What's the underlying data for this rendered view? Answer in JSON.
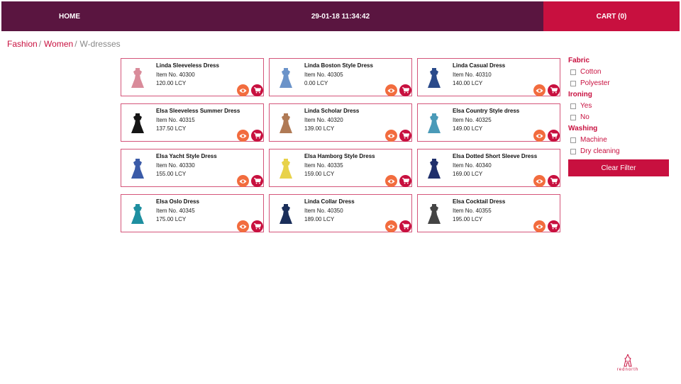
{
  "nav": {
    "home_label": "HOME",
    "clock": "29-01-18 11:34:42",
    "cart_label": "CART (0)"
  },
  "breadcrumb": {
    "items": [
      "Fashion",
      "Women",
      "W-dresses"
    ],
    "separator": "/"
  },
  "products": [
    {
      "name": "Linda Sleeveless Dress",
      "item": "Item No. 40300",
      "price": "120.00 LCY",
      "color": "#d98b9a"
    },
    {
      "name": "Linda Boston Style Dress",
      "item": "Item No. 40305",
      "price": "0.00 LCY",
      "color": "#6b93c9"
    },
    {
      "name": "Linda Casual Dress",
      "item": "Item No. 40310",
      "price": "140.00 LCY",
      "color": "#2a4a8a"
    },
    {
      "name": "Elsa Sleeveless Summer Dress",
      "item": "Item No. 40315",
      "price": "137.50 LCY",
      "color": "#151515"
    },
    {
      "name": "Linda Scholar Dress",
      "item": "Item No. 40320",
      "price": "139.00 LCY",
      "color": "#b07a55"
    },
    {
      "name": "Elsa Country Style dress",
      "item": "Item No. 40325",
      "price": "149.00 LCY",
      "color": "#4a9ab8"
    },
    {
      "name": "Elsa Yacht Style Dress",
      "item": "Item No. 40330",
      "price": "155.00 LCY",
      "color": "#3b5ba8"
    },
    {
      "name": "Elsa Hamborg Style Dress",
      "item": "Item No. 40335",
      "price": "159.00 LCY",
      "color": "#e8d24a"
    },
    {
      "name": "Elsa Dotted Short Sleeve Dress",
      "item": "Item No. 40340",
      "price": "169.00 LCY",
      "color": "#1f2f6b"
    },
    {
      "name": "Elsa Oslo Dress",
      "item": "Item No. 40345",
      "price": "175.00 LCY",
      "color": "#1e8fa0"
    },
    {
      "name": "Linda Collar Dress",
      "item": "Item No. 40350",
      "price": "189.00 LCY",
      "color": "#1a2e5a"
    },
    {
      "name": "Elsa Cocktail Dress",
      "item": "Item No. 40355",
      "price": "195.00 LCY",
      "color": "#444444"
    }
  ],
  "filters": {
    "groups": [
      {
        "title": "Fabric",
        "options": [
          "Cotton",
          "Polyester"
        ]
      },
      {
        "title": "Ironing",
        "options": [
          "Yes",
          "No"
        ]
      },
      {
        "title": "Washing",
        "options": [
          "Machine",
          "Dry cleaning"
        ]
      }
    ],
    "clear_label": "Clear Filter"
  },
  "logo": {
    "text": "rednorth"
  },
  "colors": {
    "topbar": "#5a1540",
    "accent": "#c8103f",
    "view_button": "#f26c3e"
  },
  "icons": {
    "view": "eye-icon",
    "cart": "cart-icon",
    "product": "dress-icon"
  }
}
